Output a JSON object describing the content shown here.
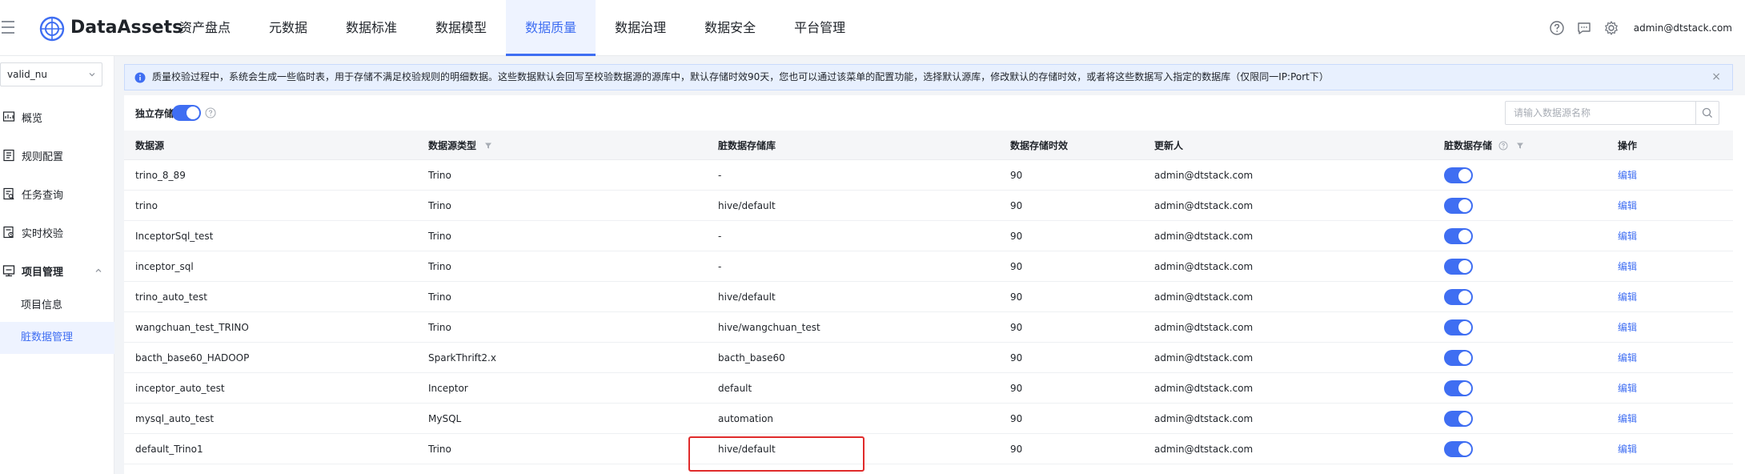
{
  "header": {
    "brand": "DataAssets",
    "nav": [
      "资产盘点",
      "元数据",
      "数据标准",
      "数据模型",
      "数据质量",
      "数据治理",
      "数据安全",
      "平台管理"
    ],
    "active_nav_index": 4,
    "user_email": "admin@dtstack.com",
    "icons": [
      "help-circle-icon",
      "message-icon",
      "settings-gear-icon"
    ]
  },
  "sidebar": {
    "project_value": "valid_nu",
    "items": [
      {
        "label": "概览",
        "icon": "overview-icon"
      },
      {
        "label": "规则配置",
        "icon": "rule-config-icon"
      },
      {
        "label": "任务查询",
        "icon": "task-query-icon"
      },
      {
        "label": "实时校验",
        "icon": "realtime-check-icon"
      },
      {
        "label": "项目管理",
        "icon": "project-manage-icon"
      }
    ],
    "sub_items": [
      "项目信息",
      "脏数据管理"
    ],
    "active_sub_index": 1
  },
  "alert": {
    "text": "质量校验过程中，系统会生成一些临时表，用于存储不满足校验规则的明细数据。这些数据默认会回写至校验数据源的源库中，默认存储时效90天，您也可以通过该菜单的配置功能，选择默认源库，修改默认的存储时效，或者将这些数据写入指定的数据库（仅限同一IP:Port下）",
    "close": "×"
  },
  "toolbar": {
    "toggle_label": "独立存储",
    "toggle_on": true,
    "search_placeholder": "请输入数据源名称"
  },
  "table": {
    "columns": [
      "数据源",
      "数据源类型",
      "脏数据存储库",
      "数据存储时效",
      "更新人",
      "脏数据存储",
      "操作"
    ],
    "rows": [
      [
        "trino_8_89",
        "Trino",
        "-",
        "90",
        "admin@dtstack.com",
        "on",
        "编辑"
      ],
      [
        "trino",
        "Trino",
        "hive/default",
        "90",
        "admin@dtstack.com",
        "on",
        "编辑"
      ],
      [
        "InceptorSql_test",
        "Trino",
        "-",
        "90",
        "admin@dtstack.com",
        "on",
        "编辑"
      ],
      [
        "inceptor_sql",
        "Trino",
        "-",
        "90",
        "admin@dtstack.com",
        "on",
        "编辑"
      ],
      [
        "trino_auto_test",
        "Trino",
        "hive/default",
        "90",
        "admin@dtstack.com",
        "on",
        "编辑"
      ],
      [
        "wangchuan_test_TRINO",
        "Trino",
        "hive/wangchuan_test",
        "90",
        "admin@dtstack.com",
        "on",
        "编辑"
      ],
      [
        "bacth_base60_HADOOP",
        "SparkThrift2.x",
        "bacth_base60",
        "90",
        "admin@dtstack.com",
        "on",
        "编辑"
      ],
      [
        "inceptor_auto_test",
        "Inceptor",
        "default",
        "90",
        "admin@dtstack.com",
        "on",
        "编辑"
      ],
      [
        "mysql_auto_test",
        "MySQL",
        "automation",
        "90",
        "admin@dtstack.com",
        "on",
        "编辑"
      ],
      [
        "default_Trino1",
        "Trino",
        "hive/default",
        "90",
        "admin@dtstack.com",
        "on",
        "编辑"
      ]
    ]
  },
  "colors": {
    "accent": "#3f6ef2",
    "highlight": "#e02b2b",
    "alert_bg": "#e8f0fe"
  }
}
